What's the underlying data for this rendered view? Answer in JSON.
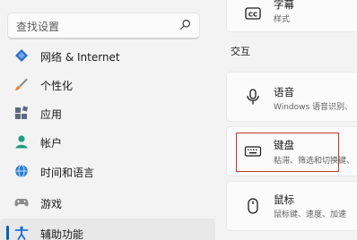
{
  "nav": {
    "search_placeholder": "查找设置",
    "items": [
      {
        "label": "网络 & Internet",
        "icon": "network-diamond-icon"
      },
      {
        "label": "个性化",
        "icon": "brush-icon"
      },
      {
        "label": "应用",
        "icon": "apps-icon"
      },
      {
        "label": "帐户",
        "icon": "account-icon"
      },
      {
        "label": "时间和语言",
        "icon": "time-language-icon"
      },
      {
        "label": "游戏",
        "icon": "gamepad-icon"
      },
      {
        "label": "辅助功能",
        "icon": "accessibility-icon"
      }
    ],
    "active_item": "辅助功能",
    "accent_color": "#005fb8"
  },
  "content": {
    "top_card": {
      "title": "字幕",
      "subtitle": "样式",
      "icon": "cc-icon"
    },
    "section_title": "交互",
    "cards": [
      {
        "title": "语音",
        "subtitle": "Windows 语音识别、",
        "icon": "microphone-icon"
      },
      {
        "title": "键盘",
        "subtitle": "粘滞、筛选和切换键、",
        "icon": "keyboard-icon"
      },
      {
        "title": "鼠标",
        "subtitle": "鼠标键、速度、加速",
        "icon": "mouse-icon"
      }
    ],
    "highlight_color": "#c0392b"
  }
}
